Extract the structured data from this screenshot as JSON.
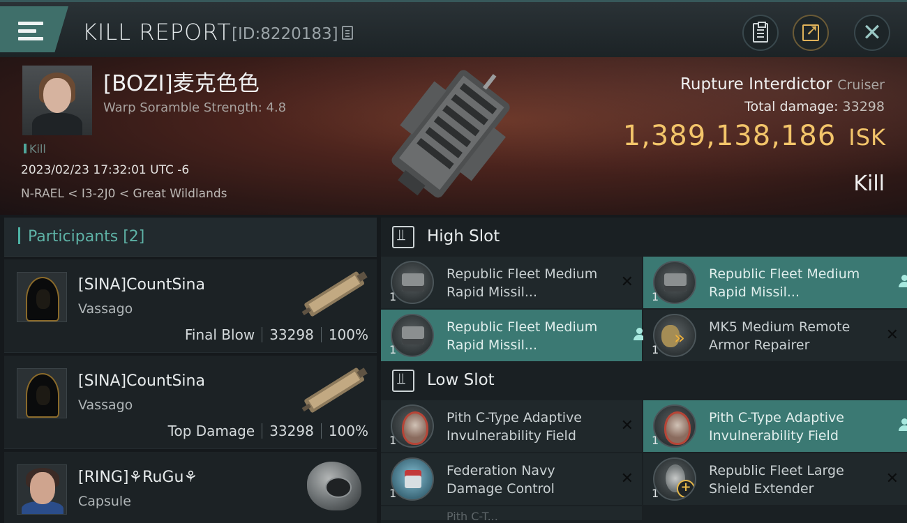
{
  "header": {
    "title": "KILL REPORT",
    "report_id": "[ID:8220183]"
  },
  "victim": {
    "name": "[BOZI]麦克色色",
    "stat": "Warp Soramble Strength: 4.8",
    "tag": "Kill",
    "datetime": "2023/02/23 17:32:01 UTC -6",
    "location": "N-RAEL < I3-2J0 < Great Wildlands",
    "ship": "Rupture Interdictor",
    "ship_class": "Cruiser",
    "total_damage_label": "Total damage:",
    "total_damage": "33298",
    "isk_value": "1,389,138,186",
    "isk_unit": "ISK",
    "result": "Kill"
  },
  "participants": {
    "title": "Participants [2]",
    "items": [
      {
        "name": "[SINA]CountSina",
        "ship": "Vassago",
        "role": "Final Blow",
        "damage": "33298",
        "percent": "100%"
      },
      {
        "name": "[SINA]CountSina",
        "ship": "Vassago",
        "role": "Top Damage",
        "damage": "33298",
        "percent": "100%"
      },
      {
        "name": "[RING]⚘RuGu⚘",
        "ship": "Capsule"
      }
    ]
  },
  "slots": {
    "high": {
      "title": "High Slot",
      "modules": [
        {
          "name": "Republic Fleet Medium Rapid Missil...",
          "qty": "1",
          "state": "✕"
        },
        {
          "name": "Republic Fleet Medium Rapid Missil...",
          "qty": "1",
          "state": ""
        },
        {
          "name": "Republic Fleet Medium Rapid Missil...",
          "qty": "1",
          "state": ""
        },
        {
          "name": "MK5 Medium Remote Armor Repairer",
          "qty": "1",
          "state": "✕"
        }
      ]
    },
    "low": {
      "title": "Low Slot",
      "modules": [
        {
          "name": "Pith C-Type Adaptive Invulnerability Field",
          "qty": "1",
          "state": "✕"
        },
        {
          "name": "Pith C-Type Adaptive Invulnerability Field",
          "qty": "1",
          "state": ""
        },
        {
          "name": "Federation Navy Damage Control",
          "qty": "1",
          "state": "✕"
        },
        {
          "name": "Republic Fleet Large Shield Extender",
          "qty": "1",
          "state": "✕"
        }
      ],
      "partial": "Pith C-T..."
    }
  }
}
